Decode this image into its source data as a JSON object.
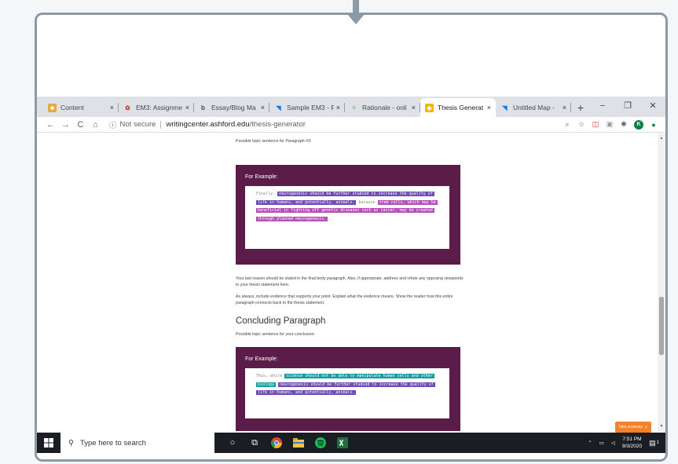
{
  "browser": {
    "tabs": [
      {
        "title": "Content",
        "favicon": "content-icon",
        "color": "#e8a93a",
        "active": false
      },
      {
        "title": "EM3: Assignme",
        "favicon": "gift-icon",
        "color": "#d93025",
        "active": false
      },
      {
        "title": "Essay/Blog Ma",
        "favicon": "bing-icon",
        "color": "#444444",
        "active": false
      },
      {
        "title": "Sample EM3 - F",
        "favicon": "flag-icon",
        "color": "#1a73e8",
        "active": false
      },
      {
        "title": "Rationale - onli",
        "favicon": "dots-icon",
        "color": "#34a853",
        "active": false
      },
      {
        "title": "Thesis Generat",
        "favicon": "shield-icon",
        "color": "#f4b400",
        "active": true
      },
      {
        "title": "Untitled Map - ",
        "favicon": "flag-icon",
        "color": "#1a73e8",
        "active": false
      }
    ],
    "close_glyph": "×",
    "new_tab": "+",
    "window_controls": {
      "minimize": "−",
      "restore": "❐",
      "close": "✕"
    },
    "security": "Not secure",
    "url_domain": "writingcenter.ashford.edu",
    "url_path": "/thesis-generator",
    "profile_initial": "K"
  },
  "page": {
    "p3_intro": "Possible topic sentence for Paragraph #3:",
    "card1": {
      "label": "For Example:",
      "lead": "Finally,",
      "hl1": "neurogenesis should be further studied to increase the quality of",
      "hl1b": "life in humans, and potentially, animals.",
      "because": "because",
      "hl2": "stem cells, which may be",
      "hl2b": "beneficial in fighting off genetic diseases such as cancer, may be created",
      "hl2c": "through planned neurogenesis."
    },
    "para1": "Your last reason should be stated in the final body paragraph. Also, if appropriate, address and refute any opposing viewpoints to your thesis statement here.",
    "para2": "As always, include evidence that supports your point. Explain what the evidence means. Show the reader how this entire paragraph connects back to the thesis statement.",
    "concluding_heading": "Concluding Paragraph",
    "conclusion_intro": "Possible topic sentence for your conclusion:",
    "card2": {
      "label": "For Example:",
      "lead": "Thus, while",
      "hl1": "science should not be able to manipulate human cells and other",
      "hl1b": "biology",
      "hl2": "neurogenesis should be further studied to increase the quality of",
      "hl2b": "life in humans, and potentially, animals."
    },
    "survey_button": "Take a survey"
  },
  "taskbar": {
    "search_placeholder": "Type here to search",
    "time": "7:51 PM",
    "date": "9/3/2020",
    "notifications": "1"
  }
}
